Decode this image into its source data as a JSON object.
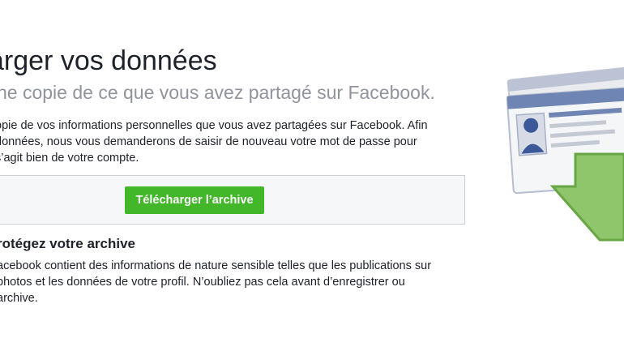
{
  "header": {
    "title": "arger vos données",
    "subtitle": "ne copie de ce que vous avez partagé sur Facebook."
  },
  "description": {
    "lines": [
      "opie de vos informations personnelles que vous avez partagées sur Facebook. Afin",
      " données, nous vous demanderons de saisir de nouveau votre mot de passe pour",
      "s’agit bien de votre compte."
    ]
  },
  "download": {
    "button_label": "Télécharger l’archive"
  },
  "protect": {
    "title": "rotégez votre archive",
    "lines": [
      "acebook contient des informations de nature sensible telles que les publications sur",
      "photos et les données de votre profil. N’oubliez pas cela avant d’enregistrer ou",
      " archive."
    ]
  },
  "colors": {
    "button_green": "#42b72a",
    "title_text": "#1d2129",
    "subtitle_gray": "#90949c",
    "box_bg": "#f6f7f9",
    "arrow_green": "#8fc66b"
  },
  "icons": {
    "illustration": "profile-card-download-icon"
  }
}
